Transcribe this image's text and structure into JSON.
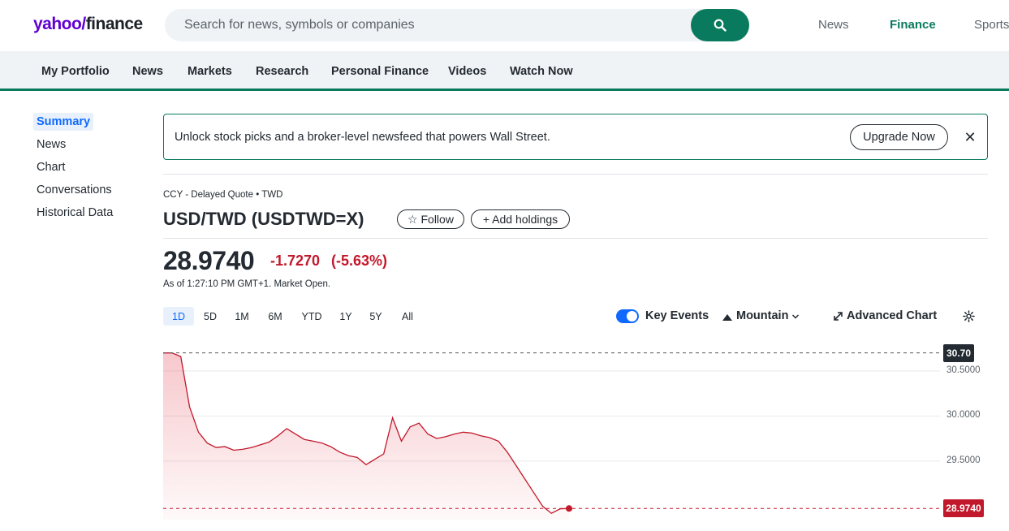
{
  "header": {
    "logo_yahoo": "yahoo/",
    "logo_finance": "finance",
    "search_placeholder": "Search for news, symbols or companies",
    "nav": [
      "News",
      "Finance",
      "Sports"
    ]
  },
  "subnav": [
    "My Portfolio",
    "News",
    "Markets",
    "Research",
    "Personal Finance",
    "Videos",
    "Watch Now"
  ],
  "leftnav": [
    "Summary",
    "News",
    "Chart",
    "Conversations",
    "Historical Data"
  ],
  "banner": {
    "text": "Unlock stock picks and a broker-level newsfeed that powers Wall Street.",
    "button": "Upgrade Now",
    "close": "✕"
  },
  "quote": {
    "meta": "CCY - Delayed Quote • TWD",
    "title": "USD/TWD (USDTWD=X)",
    "follow": "☆ Follow",
    "add_holdings": "+ Add holdings",
    "price": "28.9740",
    "change": "-1.7270",
    "change_pct": "(-5.63%)",
    "as_of": "As of 1:27:10 PM GMT+1. Market Open."
  },
  "chart_controls": {
    "ranges": [
      "1D",
      "5D",
      "1M",
      "6M",
      "YTD",
      "1Y",
      "5Y",
      "All"
    ],
    "active_range": "1D",
    "key_events": "Key Events",
    "key_events_on": true,
    "chart_type": "Mountain",
    "advanced": "Advanced Chart"
  },
  "colors": {
    "brand_green": "#0a7a5f",
    "negative": "#c2182b",
    "accent_blue": "#0f69ff"
  },
  "chart_data": {
    "type": "area",
    "ylim": [
      28.85,
      30.85
    ],
    "yticks": [
      "30.5000",
      "30.0000",
      "29.5000"
    ],
    "ytick_values": [
      30.5,
      30.0,
      29.5
    ],
    "high_label": "30.70",
    "high_value": 30.7,
    "last_label": "28.9740",
    "last_value": 28.974,
    "previous_close": 30.7,
    "values": [
      30.7,
      30.7,
      30.66,
      30.1,
      29.82,
      29.7,
      29.65,
      29.66,
      29.62,
      29.63,
      29.65,
      29.68,
      29.71,
      29.78,
      29.86,
      29.8,
      29.74,
      29.72,
      29.7,
      29.66,
      29.6,
      29.56,
      29.54,
      29.46,
      29.52,
      29.58,
      29.98,
      29.72,
      29.88,
      29.92,
      29.8,
      29.75,
      29.77,
      29.8,
      29.82,
      29.81,
      29.78,
      29.76,
      29.72,
      29.6,
      29.45,
      29.3,
      29.15,
      29.0,
      28.92,
      28.97,
      28.974
    ]
  }
}
